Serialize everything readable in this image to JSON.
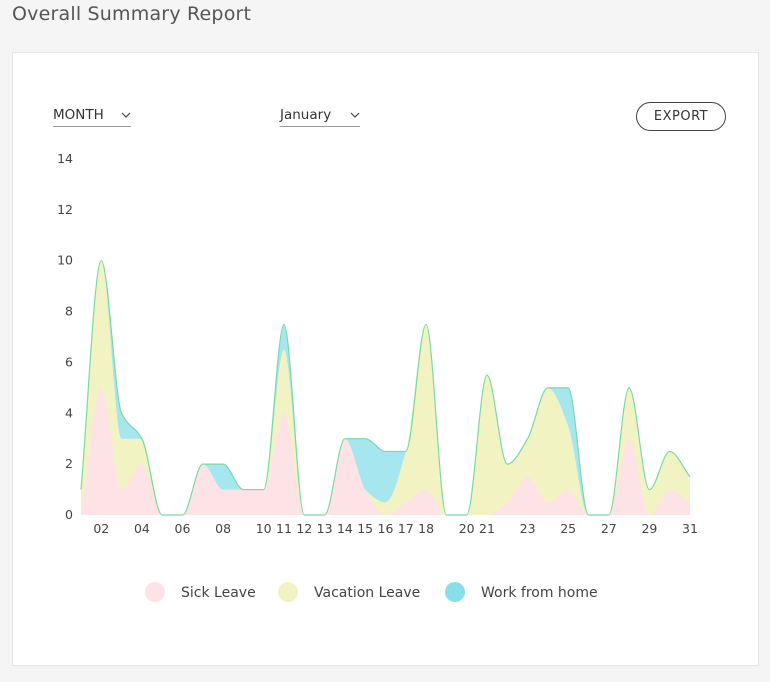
{
  "header": {
    "title": "Overall Summary Report"
  },
  "controls": {
    "period_type": "MONTH",
    "period_value": "January",
    "export_label": "EXPORT"
  },
  "colors": {
    "sick": "#fde2e6",
    "vacation": "#f2f3c3",
    "wfh": "#a6e6ee",
    "line": "#7ad9a4"
  },
  "chart_data": {
    "type": "area",
    "stacked": true,
    "x": [
      1,
      2,
      3,
      4,
      5,
      6,
      7,
      8,
      9,
      10,
      11,
      12,
      13,
      14,
      15,
      16,
      17,
      18,
      19,
      20,
      21,
      22,
      23,
      24,
      25,
      26,
      27,
      28,
      29,
      30,
      31
    ],
    "x_tick_labels": [
      "02",
      "04",
      "06",
      "08",
      "10",
      "11",
      "12",
      "13",
      "14",
      "15",
      "16",
      "17",
      "18",
      "20",
      "21",
      "23",
      "25",
      "27",
      "29",
      "31"
    ],
    "x_tick_values": [
      2,
      4,
      6,
      8,
      10,
      11,
      12,
      13,
      14,
      15,
      16,
      17,
      18,
      20,
      21,
      23,
      25,
      27,
      29,
      31
    ],
    "series": [
      {
        "name": "Sick Leave",
        "color": "#fde2e6",
        "values": [
          0,
          5,
          1,
          2,
          0,
          0,
          2,
          1,
          1,
          1,
          4,
          0,
          0,
          3,
          1,
          0,
          0.5,
          1,
          0,
          0,
          0,
          0.5,
          1.5,
          0.5,
          1,
          0,
          0,
          3,
          0,
          1,
          0.5
        ]
      },
      {
        "name": "Vacation Leave",
        "color": "#f2f3c3",
        "values": [
          1,
          5,
          2,
          1,
          0,
          0,
          0,
          0,
          0,
          0,
          2.5,
          0,
          0,
          0,
          0,
          0.5,
          2,
          6.5,
          0,
          0,
          5.5,
          1.5,
          1.5,
          4.5,
          2.5,
          0,
          0,
          2,
          1,
          1.5,
          1
        ]
      },
      {
        "name": "Work from home",
        "color": "#a6e6ee",
        "values": [
          0,
          0,
          1,
          0,
          0,
          0,
          0,
          1,
          0,
          0,
          1,
          0,
          0,
          0,
          2,
          2,
          0,
          0,
          0,
          0,
          0,
          0,
          0,
          0,
          1.5,
          0,
          0,
          0,
          0,
          0,
          0
        ]
      }
    ],
    "y_ticks": [
      0,
      2,
      4,
      6,
      8,
      10,
      12,
      14
    ],
    "ylim": [
      0,
      14
    ],
    "xlim": [
      1,
      31
    ],
    "grid": false,
    "legend_position": "bottom"
  }
}
